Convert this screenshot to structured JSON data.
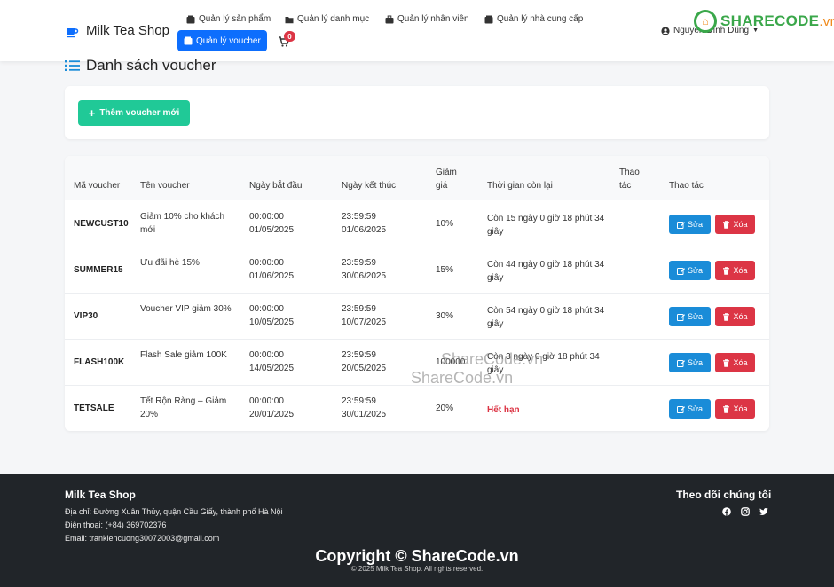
{
  "navbar": {
    "brand": "Milk Tea Shop",
    "items": [
      {
        "label": "Quản lý sản phẩm"
      },
      {
        "label": "Quản lý danh mục"
      },
      {
        "label": "Quản lý nhân viên"
      },
      {
        "label": "Quản lý nhà cung cấp"
      },
      {
        "label": "Quản lý voucher"
      }
    ],
    "cart_count": "0",
    "user_name": "Nguyễn Đình Dũng"
  },
  "watermark": {
    "logo_text": "SHARECODE",
    "logo_tld": ".vn",
    "text1": "ShareCode.vn",
    "text2": "ShareCode.vn",
    "copyright": "Copyright © ShareCode.vn"
  },
  "page": {
    "title": "Danh sách voucher",
    "add_button": "Thêm voucher mới"
  },
  "table": {
    "headers": {
      "code": "Mã voucher",
      "name": "Tên voucher",
      "start": "Ngày bắt đầu",
      "end": "Ngày kết thúc",
      "discount_1": "Giảm",
      "discount_2": "giá",
      "remaining": "Thời gian còn lại",
      "action_a1": "Thao",
      "action_a2": "tác",
      "action_b": "Thao tác"
    },
    "rows": [
      {
        "code": "NEWCUST10",
        "name_1": "Giảm 10% cho khách",
        "name_2": "mới",
        "start_time": "00:00:00",
        "start_date": "01/05/2025",
        "end_time": "23:59:59",
        "end_date": "01/06/2025",
        "discount": "10%",
        "remaining_1": "Còn 15 ngày 0 giờ 18 phút 34",
        "remaining_2": "giây",
        "edit": "Sửa",
        "delete": "Xóa"
      },
      {
        "code": "SUMMER15",
        "name_1": "Ưu đãi hè 15%",
        "name_2": "",
        "start_time": "00:00:00",
        "start_date": "01/06/2025",
        "end_time": "23:59:59",
        "end_date": "30/06/2025",
        "discount": "15%",
        "remaining_1": "Còn 44 ngày 0 giờ 18 phút 34",
        "remaining_2": "giây",
        "edit": "Sửa",
        "delete": "Xóa"
      },
      {
        "code": "VIP30",
        "name_1": "Voucher VIP giảm 30%",
        "name_2": "",
        "start_time": "00:00:00",
        "start_date": "10/05/2025",
        "end_time": "23:59:59",
        "end_date": "10/07/2025",
        "discount": "30%",
        "remaining_1": "Còn 54 ngày 0 giờ 18 phút 34",
        "remaining_2": "giây",
        "edit": "Sửa",
        "delete": "Xóa"
      },
      {
        "code": "FLASH100K",
        "name_1": "Flash Sale giảm 100K",
        "name_2": "",
        "start_time": "00:00:00",
        "start_date": "14/05/2025",
        "end_time": "23:59:59",
        "end_date": "20/05/2025",
        "discount": "100000",
        "remaining_1": "Còn 3 ngày 0 giờ 18 phút 34",
        "remaining_2": "giây",
        "edit": "Sửa",
        "delete": "Xóa"
      },
      {
        "code": "TETSALE",
        "name_1": "Tết Rộn Ràng – Giảm",
        "name_2": "20%",
        "start_time": "00:00:00",
        "start_date": "20/01/2025",
        "end_time": "23:59:59",
        "end_date": "30/01/2025",
        "discount": "20%",
        "remaining_1": "Hết hạn",
        "remaining_2": "",
        "expired": true,
        "edit": "Sửa",
        "delete": "Xóa"
      }
    ]
  },
  "footer": {
    "title": "Milk Tea Shop",
    "address": "Địa chỉ: Đường Xuân Thủy, quận Cầu Giấy, thành phố Hà Nội",
    "phone": "Điện thoại: (+84) 369702376",
    "email": "Email: trankiencuong30072003@gmail.com",
    "follow": "Theo dõi chúng tôi",
    "copyright": "© 2025 Milk Tea Shop. All rights reserved."
  },
  "colors": {
    "primary": "#0d6efd",
    "success": "#20c997",
    "danger": "#dc3545",
    "edit": "#1a8cd8",
    "footer_bg": "#212529"
  }
}
